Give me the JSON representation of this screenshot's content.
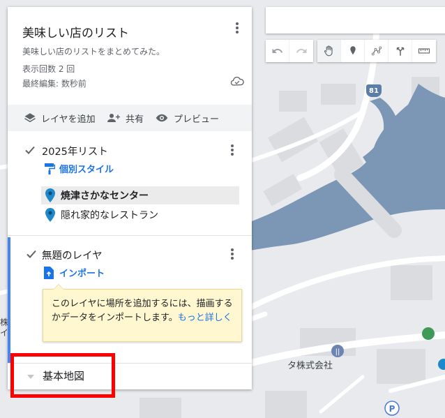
{
  "map": {
    "route_number": "81",
    "company_label": "タ株式会社",
    "edge_label": "株\nイ",
    "colors": {
      "land": "#e8eaed",
      "water": "#7c96b5",
      "road": "#ffffff",
      "building": "#dadce0"
    }
  },
  "panel": {
    "title": "美味しい店のリスト",
    "description": "美味しい店のリストをまとめてみた。",
    "views": "表示回数 2 回",
    "last_edited": "最終編集: 数秒前",
    "actions": {
      "add_layer": "レイヤを追加",
      "share": "共有",
      "preview": "プレビュー"
    }
  },
  "layers": [
    {
      "name": "2025年リスト",
      "style_link": "個別スタイル",
      "places": [
        "焼津さかなセンター",
        "隠れ家的なレストラン"
      ]
    },
    {
      "name": "無題のレイヤ",
      "import_link": "インポート",
      "tooltip": {
        "text": "このレイヤに場所を追加するには、描画するかデータをインポートします。",
        "link": "もっと詳しく"
      }
    }
  ],
  "base_map": {
    "label": "基本地図"
  },
  "toolbar": {
    "buttons": [
      "undo-icon",
      "redo-icon",
      "pan-hand-icon",
      "add-marker-icon",
      "draw-line-icon",
      "directions-icon",
      "ruler-icon"
    ],
    "active": "pan-hand-icon"
  }
}
